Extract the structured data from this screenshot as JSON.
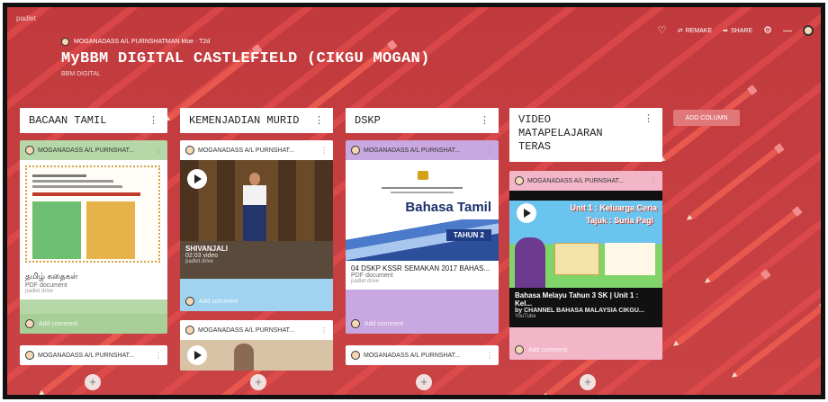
{
  "app": {
    "name": "padlet"
  },
  "topbar": {
    "remake_label": "REMAKE",
    "share_label": "SHARE"
  },
  "board": {
    "author": "MOGANADASS A/L PURNSHATMAN Moe · T2d",
    "title": "MyBBM DIGITAL CASTLEFIELD (CIKGU MOGAN)",
    "subtitle": "BBM DIGITAL"
  },
  "add_column_label": "ADD COLUMN",
  "columns": [
    {
      "title": "BACAAN TAMIL",
      "cards": [
        {
          "author": "MOGANADASS A/L PURNSHAT...",
          "title": "தமிழ் கதைகள்",
          "meta": "PDF document",
          "source": "padlet drive"
        },
        {
          "author": "MOGANADASS A/L PURNSHAT..."
        }
      ],
      "comment_placeholder": "Add comment"
    },
    {
      "title": "KEMENJADIAN MURID",
      "cards": [
        {
          "author": "MOGANADASS A/L PURNSHAT...",
          "title": "SHIVANJALI",
          "meta": "02:03 video",
          "source": "padlet drive"
        },
        {
          "author": "MOGANADASS A/L PURNSHAT..."
        }
      ],
      "comment_placeholder": "Add comment"
    },
    {
      "title": "DSKP",
      "cards": [
        {
          "author": "MOGANADASS A/L PURNSHAT...",
          "doc_heading": "Bahasa Tamil",
          "doc_badge": "TAHUN 2",
          "title": "04 DSKP KSSR SEMAKAN 2017 BAHAS...",
          "meta": "PDF document",
          "source": "padlet drive"
        },
        {
          "author": "MOGANADASS A/L PURNSHAT..."
        }
      ],
      "comment_placeholder": "Add comment"
    },
    {
      "title": "VIDEO MATAPELAJARAN TERAS",
      "cards": [
        {
          "author": "MOGANADASS A/L PURNSHAT...",
          "video_overlay_1": "Unit 1 : Keluarga Ceria",
          "video_overlay_2": "Tajuk : Suria Pagi",
          "title": "Bahasa Melayu Tahun 3 SK | Unit 1 : Kel...",
          "meta": "by CHANNEL BAHASA MALAYSIA CIKGU...",
          "source": "YouTube"
        }
      ],
      "comment_placeholder": "Add comment"
    }
  ],
  "add_post_symbol": "+",
  "colors": {
    "board_bg": "#c33b3e",
    "card_green": "#b6d7a8",
    "card_blue": "#9fd3ef",
    "card_purple": "#c9a7e0",
    "card_pink": "#f2b6c8"
  }
}
